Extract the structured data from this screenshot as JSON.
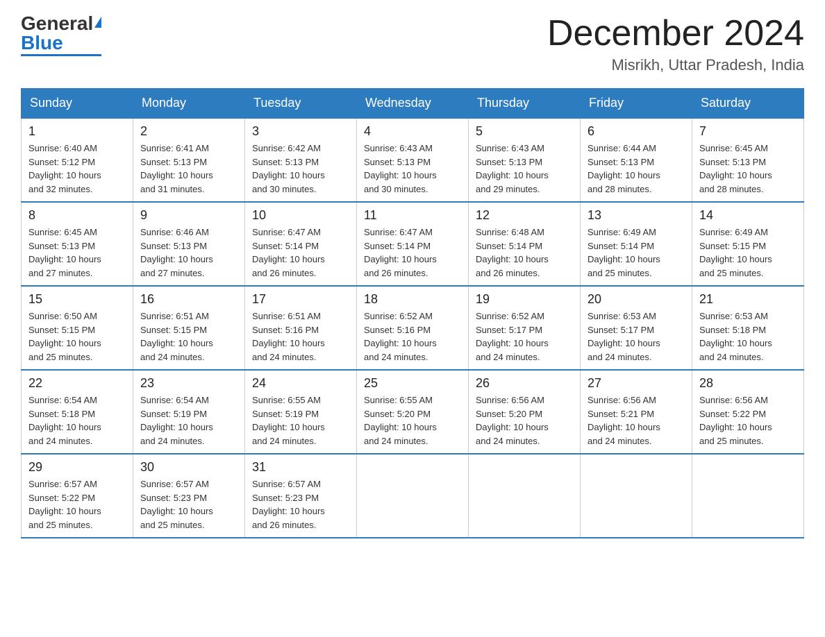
{
  "header": {
    "logo_general": "General",
    "logo_blue": "Blue",
    "main_title": "December 2024",
    "subtitle": "Misrikh, Uttar Pradesh, India"
  },
  "days_of_week": [
    "Sunday",
    "Monday",
    "Tuesday",
    "Wednesday",
    "Thursday",
    "Friday",
    "Saturday"
  ],
  "weeks": [
    [
      {
        "day": "1",
        "sunrise": "6:40 AM",
        "sunset": "5:12 PM",
        "daylight": "10 hours and 32 minutes."
      },
      {
        "day": "2",
        "sunrise": "6:41 AM",
        "sunset": "5:13 PM",
        "daylight": "10 hours and 31 minutes."
      },
      {
        "day": "3",
        "sunrise": "6:42 AM",
        "sunset": "5:13 PM",
        "daylight": "10 hours and 30 minutes."
      },
      {
        "day": "4",
        "sunrise": "6:43 AM",
        "sunset": "5:13 PM",
        "daylight": "10 hours and 30 minutes."
      },
      {
        "day": "5",
        "sunrise": "6:43 AM",
        "sunset": "5:13 PM",
        "daylight": "10 hours and 29 minutes."
      },
      {
        "day": "6",
        "sunrise": "6:44 AM",
        "sunset": "5:13 PM",
        "daylight": "10 hours and 28 minutes."
      },
      {
        "day": "7",
        "sunrise": "6:45 AM",
        "sunset": "5:13 PM",
        "daylight": "10 hours and 28 minutes."
      }
    ],
    [
      {
        "day": "8",
        "sunrise": "6:45 AM",
        "sunset": "5:13 PM",
        "daylight": "10 hours and 27 minutes."
      },
      {
        "day": "9",
        "sunrise": "6:46 AM",
        "sunset": "5:13 PM",
        "daylight": "10 hours and 27 minutes."
      },
      {
        "day": "10",
        "sunrise": "6:47 AM",
        "sunset": "5:14 PM",
        "daylight": "10 hours and 26 minutes."
      },
      {
        "day": "11",
        "sunrise": "6:47 AM",
        "sunset": "5:14 PM",
        "daylight": "10 hours and 26 minutes."
      },
      {
        "day": "12",
        "sunrise": "6:48 AM",
        "sunset": "5:14 PM",
        "daylight": "10 hours and 26 minutes."
      },
      {
        "day": "13",
        "sunrise": "6:49 AM",
        "sunset": "5:14 PM",
        "daylight": "10 hours and 25 minutes."
      },
      {
        "day": "14",
        "sunrise": "6:49 AM",
        "sunset": "5:15 PM",
        "daylight": "10 hours and 25 minutes."
      }
    ],
    [
      {
        "day": "15",
        "sunrise": "6:50 AM",
        "sunset": "5:15 PM",
        "daylight": "10 hours and 25 minutes."
      },
      {
        "day": "16",
        "sunrise": "6:51 AM",
        "sunset": "5:15 PM",
        "daylight": "10 hours and 24 minutes."
      },
      {
        "day": "17",
        "sunrise": "6:51 AM",
        "sunset": "5:16 PM",
        "daylight": "10 hours and 24 minutes."
      },
      {
        "day": "18",
        "sunrise": "6:52 AM",
        "sunset": "5:16 PM",
        "daylight": "10 hours and 24 minutes."
      },
      {
        "day": "19",
        "sunrise": "6:52 AM",
        "sunset": "5:17 PM",
        "daylight": "10 hours and 24 minutes."
      },
      {
        "day": "20",
        "sunrise": "6:53 AM",
        "sunset": "5:17 PM",
        "daylight": "10 hours and 24 minutes."
      },
      {
        "day": "21",
        "sunrise": "6:53 AM",
        "sunset": "5:18 PM",
        "daylight": "10 hours and 24 minutes."
      }
    ],
    [
      {
        "day": "22",
        "sunrise": "6:54 AM",
        "sunset": "5:18 PM",
        "daylight": "10 hours and 24 minutes."
      },
      {
        "day": "23",
        "sunrise": "6:54 AM",
        "sunset": "5:19 PM",
        "daylight": "10 hours and 24 minutes."
      },
      {
        "day": "24",
        "sunrise": "6:55 AM",
        "sunset": "5:19 PM",
        "daylight": "10 hours and 24 minutes."
      },
      {
        "day": "25",
        "sunrise": "6:55 AM",
        "sunset": "5:20 PM",
        "daylight": "10 hours and 24 minutes."
      },
      {
        "day": "26",
        "sunrise": "6:56 AM",
        "sunset": "5:20 PM",
        "daylight": "10 hours and 24 minutes."
      },
      {
        "day": "27",
        "sunrise": "6:56 AM",
        "sunset": "5:21 PM",
        "daylight": "10 hours and 24 minutes."
      },
      {
        "day": "28",
        "sunrise": "6:56 AM",
        "sunset": "5:22 PM",
        "daylight": "10 hours and 25 minutes."
      }
    ],
    [
      {
        "day": "29",
        "sunrise": "6:57 AM",
        "sunset": "5:22 PM",
        "daylight": "10 hours and 25 minutes."
      },
      {
        "day": "30",
        "sunrise": "6:57 AM",
        "sunset": "5:23 PM",
        "daylight": "10 hours and 25 minutes."
      },
      {
        "day": "31",
        "sunrise": "6:57 AM",
        "sunset": "5:23 PM",
        "daylight": "10 hours and 26 minutes."
      },
      null,
      null,
      null,
      null
    ]
  ],
  "labels": {
    "sunrise": "Sunrise:",
    "sunset": "Sunset:",
    "daylight": "Daylight:"
  }
}
